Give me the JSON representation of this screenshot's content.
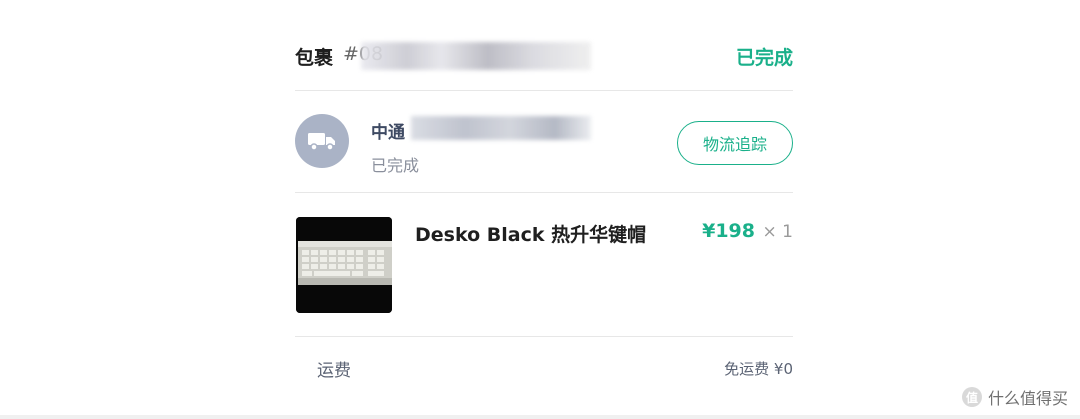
{
  "package": {
    "title": "包裹",
    "number": "#08",
    "status": "已完成"
  },
  "carrier": {
    "icon": "truck-icon",
    "name": "中通",
    "status": "已完成",
    "track_button": "物流追踪"
  },
  "item": {
    "name": "Desko Black 热升华键帽",
    "price": "¥198",
    "quantity": "× 1",
    "image": "white-mechanical-keyboard-on-black-background"
  },
  "shipping": {
    "label": "运费",
    "value": "免运费 ¥0"
  },
  "watermark": {
    "text": "什么值得买",
    "badge": "值"
  },
  "colors": {
    "accent": "#1ab08a",
    "muted_avatar": "#aab3c6",
    "divider": "#e7e7e7"
  }
}
